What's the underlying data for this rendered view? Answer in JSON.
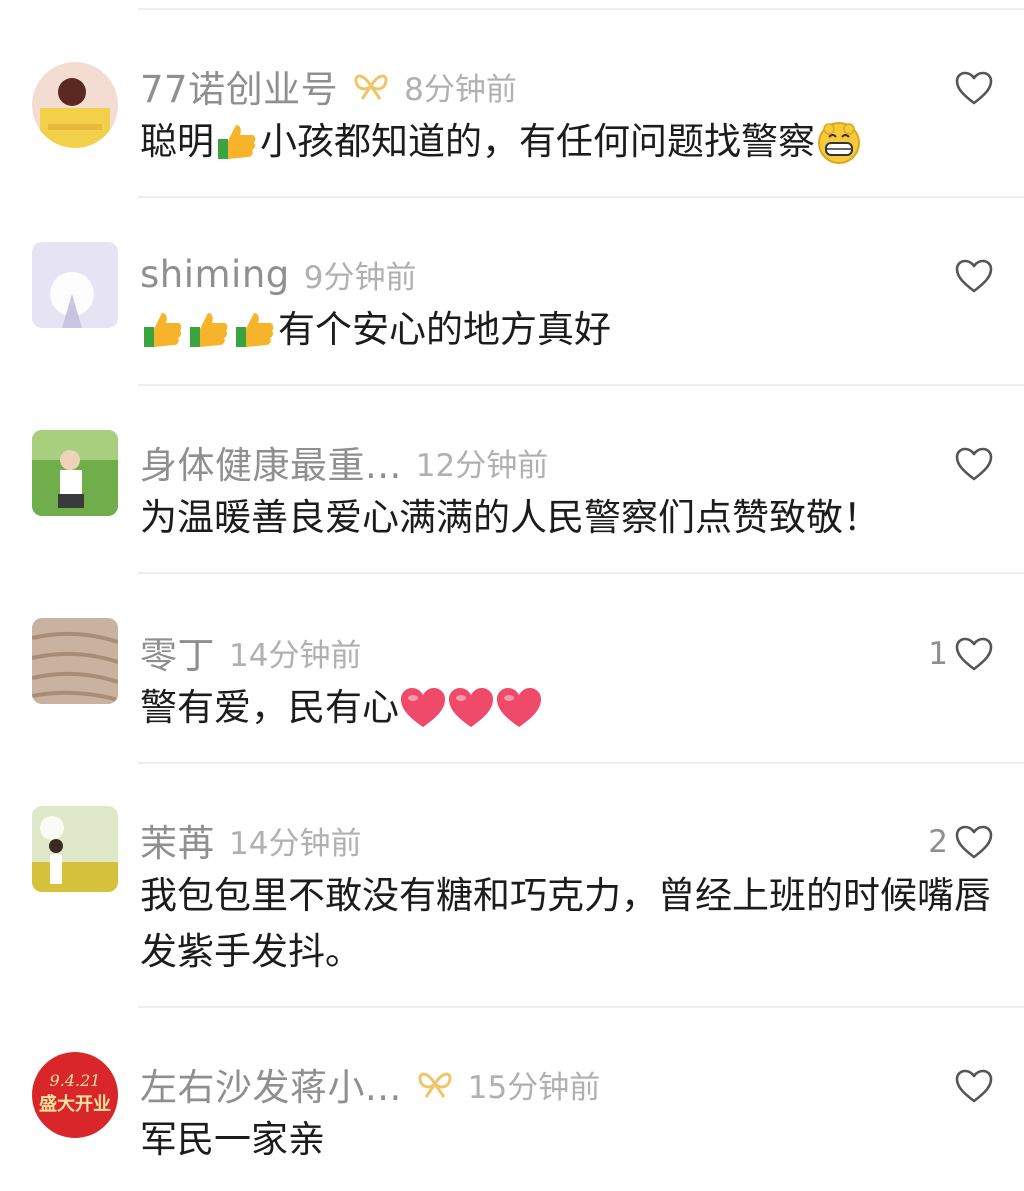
{
  "comments": [
    {
      "username": "77诺创业号",
      "time": "8分钟前",
      "has_badge": true,
      "likes": "",
      "text": "聪明",
      "text_after_emoji": "小孩都知道的，有任何问题找警察",
      "emojis": [
        "thumbs-up",
        "grin"
      ]
    },
    {
      "username": "shiming",
      "time": "9分钟前",
      "has_badge": false,
      "likes": "",
      "text": "有个安心的地方真好",
      "emojis": [
        "thumbs-up",
        "thumbs-up",
        "thumbs-up"
      ]
    },
    {
      "username": "身体健康最重...",
      "time": "12分钟前",
      "has_badge": false,
      "likes": "",
      "text": "为温暖善良爱心满满的人民警察们点赞致敬！"
    },
    {
      "username": "零丁",
      "time": "14分钟前",
      "has_badge": false,
      "likes": "1",
      "text": "警有爱，民有心",
      "emojis": [
        "heart",
        "heart",
        "heart"
      ]
    },
    {
      "username": "茉苒",
      "time": "14分钟前",
      "has_badge": false,
      "likes": "2",
      "text": "我包包里不敢没有糖和巧克力，曾经上班的时候嘴唇发紫手发抖。"
    },
    {
      "username": "左右沙发蒋小...",
      "time": "15分钟前",
      "has_badge": true,
      "likes": "",
      "text": "军民一家亲",
      "avatar_text": "9.4.21 盛大开业"
    }
  ],
  "icons": {
    "like": "heart-outline-icon",
    "badge": "bow-badge-icon"
  },
  "colors": {
    "username": "#8f8f8f",
    "time": "#b0b0b0",
    "text": "#1c1c1c",
    "badge": "#f0c46b",
    "heart_emoji": "#f04a6a"
  }
}
